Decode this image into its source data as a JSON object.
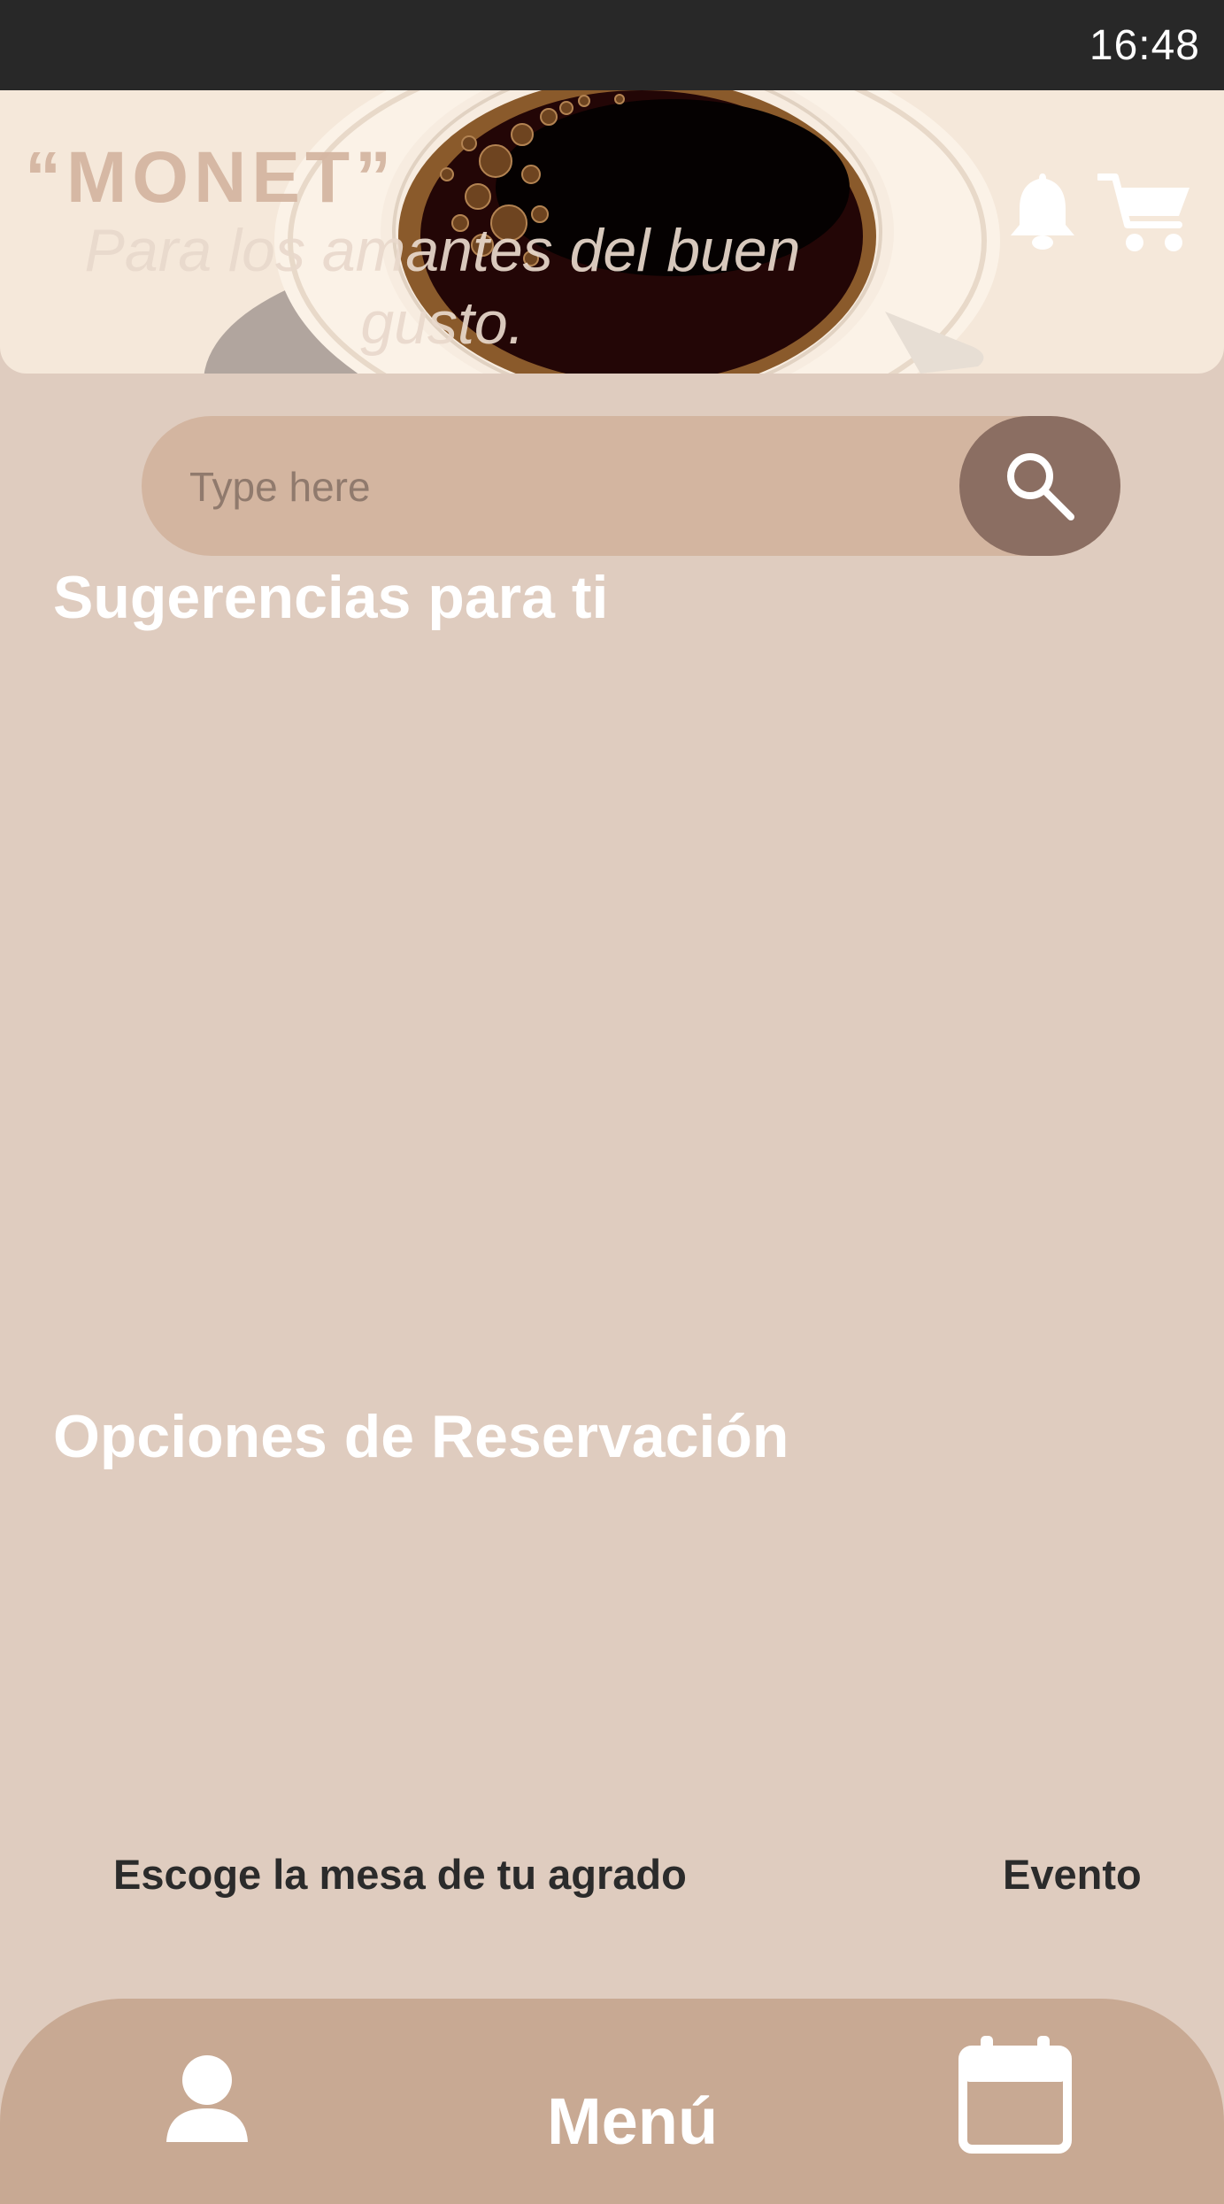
{
  "status_bar": {
    "time": "16:48"
  },
  "header": {
    "brand": "“MONET”",
    "tagline": "Para los amantes del buen gusto.",
    "icons": [
      "bell-icon",
      "cart-icon"
    ]
  },
  "search": {
    "placeholder": "Type here",
    "icon": "search-icon"
  },
  "sections": {
    "suggestions_title": "Sugerencias para ti",
    "reservations_title": "Opciones de Reservación"
  },
  "reservation_options": [
    {
      "label": "Escoge la mesa de tu agrado"
    },
    {
      "label": "Evento"
    }
  ],
  "bottom_nav": {
    "user_icon": "user-icon",
    "menu_label": "Menú",
    "calendar_icon": "calendar-icon"
  },
  "colors": {
    "background": "#dfccbf",
    "status_bar": "#282828",
    "header": "#f5e8da",
    "search_field": "#d3b5a0",
    "search_button": "#8b6e62",
    "bottom_nav": "#c8a993"
  }
}
